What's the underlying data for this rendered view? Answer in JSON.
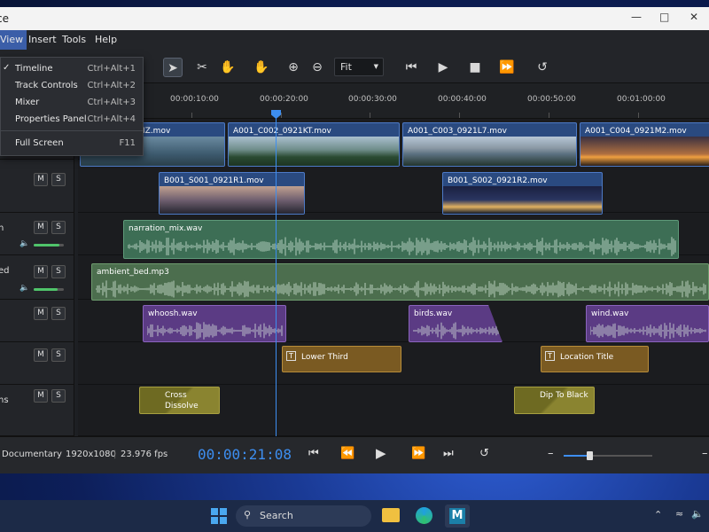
{
  "window": {
    "title": "ce"
  },
  "menu": {
    "view": "View",
    "insert": "Insert",
    "tools": "Tools",
    "help": "Help"
  },
  "view_menu": [
    {
      "label": "Timeline",
      "shortcut": "Ctrl+Alt+1",
      "checked": true
    },
    {
      "label": "Track Controls",
      "shortcut": "Ctrl+Alt+2"
    },
    {
      "label": "Mixer",
      "shortcut": "Ctrl+Alt+3"
    },
    {
      "label": "Properties Panel",
      "shortcut": "Ctrl+Alt+4"
    },
    {
      "label": "Full Screen",
      "shortcut": "F11"
    }
  ],
  "toolbar": {
    "zoom": "Fit"
  },
  "ruler": [
    "00:00:10:00",
    "00:00:20:00",
    "00:00:30:00",
    "00:00:40:00",
    "00:00:50:00",
    "00:01:00:00"
  ],
  "tracks": [
    {
      "name": "",
      "m": "M",
      "s": "S"
    },
    {
      "name": "",
      "m": "M",
      "s": "S"
    },
    {
      "name": "n",
      "m": "M",
      "s": "S"
    },
    {
      "name": "ed",
      "m": "M",
      "s": "S"
    },
    {
      "name": "",
      "m": "M",
      "s": "S"
    },
    {
      "name": "",
      "m": "M",
      "s": "S"
    },
    {
      "name": "ns",
      "m": "M",
      "s": "S"
    }
  ],
  "clips": {
    "v1a": "IZ.mov",
    "v1b": "A001_C002_0921KT.mov",
    "v1c": "A001_C003_0921L7.mov",
    "v1d": "A001_C004_0921M2.mov",
    "v2a": "B001_S001_0921R1.mov",
    "v2b": "B001_S002_0921R2.mov",
    "narr": "narration_mix.wav",
    "amb": "ambient_bed.mp3",
    "whoosh": "whoosh.wav",
    "birds": "birds.wav",
    "wind": "wind.wav",
    "lower": "Lower Third",
    "loc": "Location Title",
    "cross": "Cross Dissolve",
    "dip": "Dip To Black"
  },
  "transport": {
    "project": "Documentary",
    "res": "1920x1080",
    "fps": "23.976 fps",
    "timecode": "00:00:21:08"
  },
  "taskbar": {
    "search": "Search"
  },
  "colors": {
    "accent": "#3d8ef0",
    "menu_active": "#3b5ea8"
  }
}
